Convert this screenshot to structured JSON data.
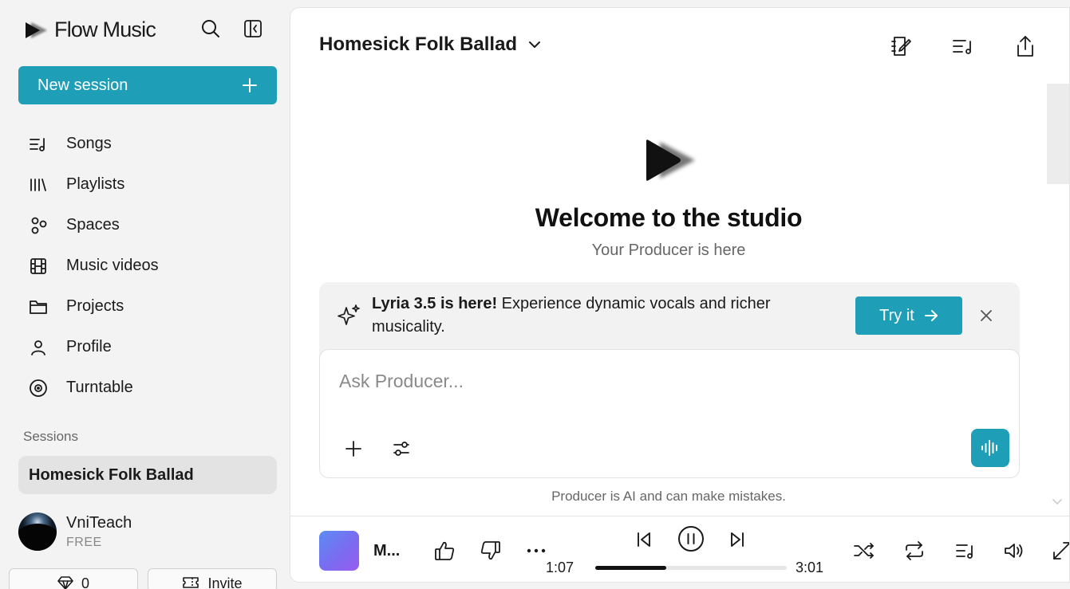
{
  "app": {
    "name": "Flow Music"
  },
  "sidebar": {
    "new_session_label": "New session",
    "items": [
      {
        "label": "Songs",
        "icon": "songs-icon"
      },
      {
        "label": "Playlists",
        "icon": "playlists-icon"
      },
      {
        "label": "Spaces",
        "icon": "spaces-icon"
      },
      {
        "label": "Music videos",
        "icon": "film-icon"
      },
      {
        "label": "Projects",
        "icon": "folder-icon"
      },
      {
        "label": "Profile",
        "icon": "person-icon"
      },
      {
        "label": "Turntable",
        "icon": "turntable-icon"
      }
    ],
    "sessions_label": "Sessions",
    "sessions": [
      {
        "label": "Homesick Folk Ballad",
        "active": true
      }
    ],
    "user": {
      "name": "VniTeach",
      "plan": "FREE"
    },
    "credits": "0",
    "invite_label": "Invite"
  },
  "main": {
    "session_title": "Homesick Folk Ballad",
    "welcome_title": "Welcome to the studio",
    "welcome_subtitle": "Your Producer is here",
    "banner": {
      "headline": "Lyria 3.5 is here!",
      "body": " Experience dynamic vocals and richer musicality.",
      "cta_label": "Try it"
    },
    "input": {
      "placeholder": "Ask Producer...",
      "value": ""
    },
    "disclaimer": "Producer is AI and can make mistakes."
  },
  "player": {
    "track_title": "M...",
    "elapsed": "1:07",
    "duration": "3:01",
    "progress": 0.37,
    "state": "playing"
  },
  "colors": {
    "accent": "#1f9eb8",
    "sidebar_bg": "#f3f3f3",
    "active_session_bg": "#e3e3e3"
  }
}
